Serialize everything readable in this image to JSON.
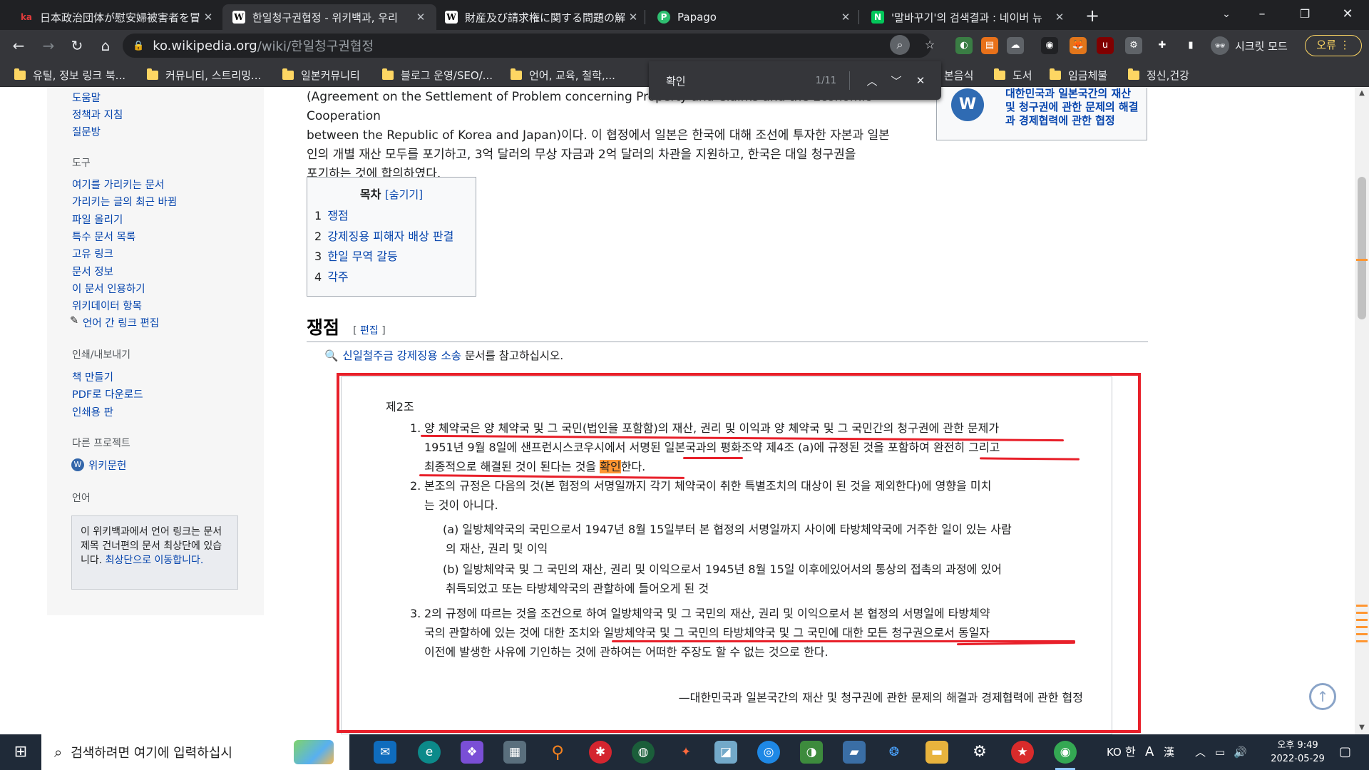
{
  "browser": {
    "tabs": [
      {
        "title": "日本政治団体が慰安婦被害者を冒",
        "favicon": "ka"
      },
      {
        "title": "한일청구권협정 - 위키백과, 우리",
        "favicon": "W"
      },
      {
        "title": "財産及び請求権に関する問題の解",
        "favicon": "W"
      },
      {
        "title": "Papago",
        "favicon": "P"
      },
      {
        "title": "'말바꾸기'의 검색결과 : 네이버 뉴",
        "favicon": "N"
      }
    ],
    "url_host": "ko.wikipedia.org",
    "url_path": "/wiki/한일청구권협정",
    "incognito_label": "시크릿 모드",
    "error_label": "오류",
    "bookmarks": [
      "유틸, 정보 링크 북...",
      "커뮤니티, 스트리밍...",
      "일본커뮤니티",
      "블로그 운영/SEO/...",
      "언어, 교육, 철학,...",
      "본음식",
      "도서",
      "임금체불",
      "정신,건강"
    ],
    "find": {
      "query": "확인",
      "count": "1/11"
    }
  },
  "sidebar": {
    "top_links": [
      "도움말",
      "정책과 지침",
      "질문방"
    ],
    "tools_heading": "도구",
    "tools": [
      "여기를 가리키는 문서",
      "가리키는 글의 최근 바뀜",
      "파일 올리기",
      "특수 문서 목록",
      "고유 링크",
      "문서 정보",
      "이 문서 인용하기",
      "위키데이터 항목",
      "언어 간 링크 편집"
    ],
    "print_heading": "인쇄/내보내기",
    "print": [
      "책 만들기",
      "PDF로 다운로드",
      "인쇄용 판"
    ],
    "projects_heading": "다른 프로젝트",
    "projects": [
      "위키문헌"
    ],
    "lang_heading": "언어",
    "lang_note": "이 위키백과에서 언어 링크는 문서 제목 건너편의 문서 최상단에 있습니다.",
    "lang_link": "최상단으로 이동합니다."
  },
  "article": {
    "intro_lines": [
      "(Agreement on the Settlement of Problem concerning Property and Claims and the Economic Cooperation",
      "between the Republic of Korea and Japan)이다. 이 협정에서 일본은 한국에 대해 조선에 투자한 자본과 일본",
      "인의 개별 재산 모두를 포기하고, 3억 달러의 무상 자금과 2억 달러의 차관을 지원하고, 한국은 대일 청구권을",
      "포기하는 것에 합의하였다."
    ],
    "infobox_text": "대한민국과 일본국간의 재산 및 청구권에 관한 문제의 해결과 경제협력에 관한 협정",
    "toc": {
      "title": "목차",
      "toggle": "[숨기기]",
      "items": [
        {
          "num": "1",
          "label": "쟁점"
        },
        {
          "num": "2",
          "label": "강제징용 피해자 배상 판결"
        },
        {
          "num": "3",
          "label": "한일 무역 갈등"
        },
        {
          "num": "4",
          "label": "각주"
        }
      ]
    },
    "section_title": "쟁점",
    "section_edit": "편집",
    "hatnote_link": "신일철주금 강제징용 소송",
    "hatnote_rest": " 문서를 참고하십시오.",
    "quote": {
      "heading": "제2조",
      "item1_num": "1.",
      "item1_l1": "양 체약국은 양 체약국 및 그 국민(법인을 포함함)의 재산, 권리 및 이익과 양 체약국 및 그 국민간의 청구권에 관한 문제가",
      "item1_l2": "1951년 9월 8일에 샌프런시스코우시에서 서명된 일본국과의 평화조약 제4조 (a)에 규정된 것을 포함하여 완전히 그리고",
      "item1_l3a": "최종적으로 해결된 것이 된다는 것을 ",
      "item1_hl": "확인",
      "item1_l3b": "한다.",
      "item2_num": "2.",
      "item2_l1": "본조의 규정은 다음의 것(본 협정의 서명일까지 각기 체약국이 취한 특별조치의 대상이 된 것을 제외한다)에 영향을 미치",
      "item2_l2": "는 것이 아니다.",
      "item2a_l1": "(a) 일방체약국의 국민으로서 1947년 8월 15일부터 본 협정의 서명일까지 사이에 타방체약국에 거주한 일이 있는 사람",
      "item2a_l2": "의 재산, 권리 및 이익",
      "item2b_l1": "(b) 일방체약국 및 그 국민의 재산, 권리 및 이익으로서 1945년 8월 15일 이후에있어서의 통상의 접촉의 과정에 있어",
      "item2b_l2": "취득되었고 또는 타방체약국의 관할하에 들어오게 된 것",
      "item3_num": "3.",
      "item3_l1": "2의 규정에 따르는 것을 조건으로 하여 일방체약국 및 그 국민의 재산, 권리 및 이익으로서 본 협정의 서명일에 타방체약",
      "item3_l2": "국의 관할하에 있는 것에 대한 조치와 일방체약국 및 그 국민의 타방체약국 및 그 국민에 대한 모든 청구권으로서 동일자",
      "item3_l3": "이전에 발생한 사유에 기인하는 것에 관하여는 어떠한 주장도 할 수 없는 것으로 한다.",
      "attribution": "—대한민국과 일본국간의 재산 및 청구권에 관한 문제의 해결과 경제협력에 관한 협정"
    }
  },
  "taskbar": {
    "search_placeholder": "검색하려면 여기에 입력하십시",
    "ime": [
      "KO",
      "한",
      "A",
      "漢"
    ],
    "time": "오후 9:49",
    "date": "2022-05-29"
  },
  "colors": {
    "annotation_red": "#e8202a",
    "find_highlight": "#ff9632",
    "link": "#0645ad"
  }
}
